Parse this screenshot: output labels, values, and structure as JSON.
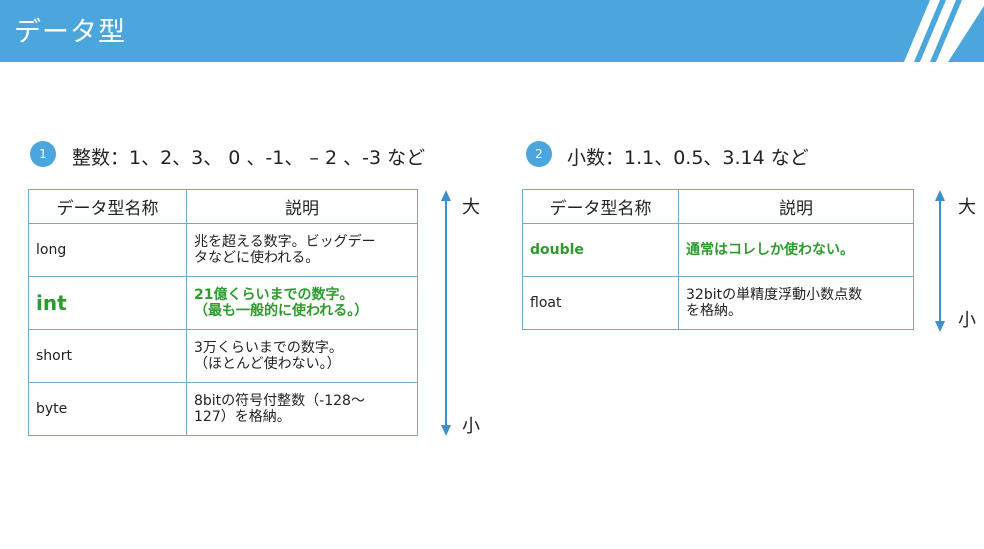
{
  "slide": {
    "title": "データ型"
  },
  "left": {
    "badge": "1",
    "heading": "整数：1、2、3、 0 、-1、 – 2 、-3 など",
    "columns": [
      "データ型名称",
      "説明"
    ],
    "rows": [
      {
        "name": "long",
        "desc1": "兆を超える数字。ビッグデー",
        "desc2": "タなどに使われる。"
      },
      {
        "name": "int",
        "desc1": "21億くらいまでの数字。",
        "desc2": "（最も一般的に使われる。）"
      },
      {
        "name": "short",
        "desc1": "3万くらいまでの数字。",
        "desc2": "（ほとんど使わない。）"
      },
      {
        "name": "byte",
        "desc1": "8bitの符号付整数（-128～",
        "desc2": "127）を格納。"
      }
    ],
    "scale_big": "大",
    "scale_small": "小"
  },
  "right": {
    "badge": "2",
    "heading": "小数：1.1、0.5、3.14 など",
    "columns": [
      "データ型名称",
      "説明"
    ],
    "rows": [
      {
        "name": "double",
        "desc1": "通常はコレしか使わない。",
        "desc2": ""
      },
      {
        "name": "float",
        "desc1": "32bitの単精度浮動小数点数",
        "desc2": "を格納。"
      }
    ],
    "scale_big": "大",
    "scale_small": "小"
  },
  "colors": {
    "header": "#4aa6dc",
    "highlight": "#2e9b2e",
    "border": "#7aa8c8"
  }
}
